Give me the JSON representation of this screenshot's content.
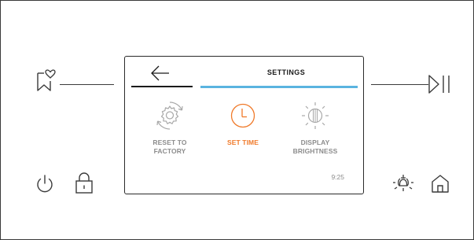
{
  "screen": {
    "title": "SETTINGS",
    "time": "9:25",
    "options": [
      {
        "label": "RESET TO\nFACTORY",
        "icon": "reset-gear-icon",
        "active": false
      },
      {
        "label": "SET TIME",
        "icon": "clock-icon",
        "active": true
      },
      {
        "label": "DISPLAY\nBRIGHTNESS",
        "icon": "brightness-icon",
        "active": false
      }
    ]
  },
  "panel": {
    "left_icons": [
      "favorite-bookmark-icon",
      "power-icon",
      "lock-icon"
    ],
    "right_icons": [
      "play-pause-icon",
      "lamp-icon",
      "home-icon"
    ]
  },
  "colors": {
    "accent_orange": "#f07a2a",
    "accent_blue": "#5ab4e0",
    "inactive_gray": "#8c8c8c",
    "line": "#3a3a3a"
  }
}
